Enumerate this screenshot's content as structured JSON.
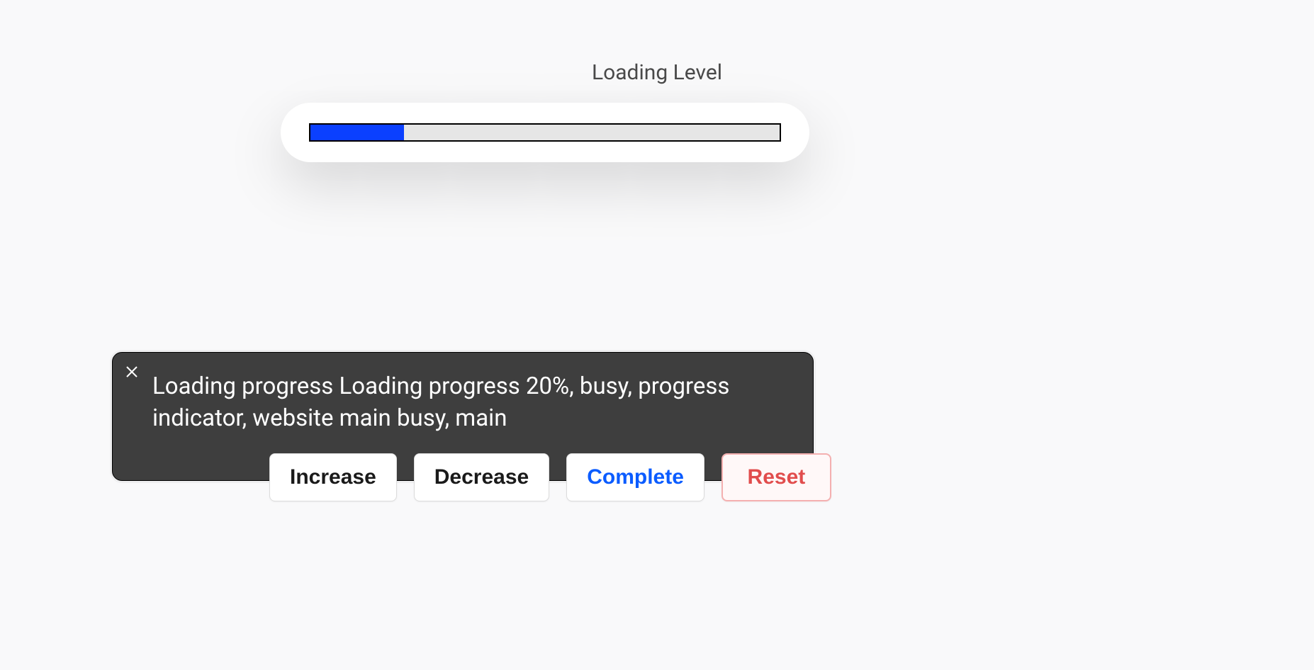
{
  "title": "Loading Level",
  "progress": {
    "percent": 20
  },
  "tooltip": {
    "text": "Loading progress Loading progress 20%, busy, progress indicator, website main busy, main"
  },
  "buttons": {
    "increase": "Increase",
    "decrease": "Decrease",
    "complete": "Complete",
    "reset": "Reset"
  }
}
